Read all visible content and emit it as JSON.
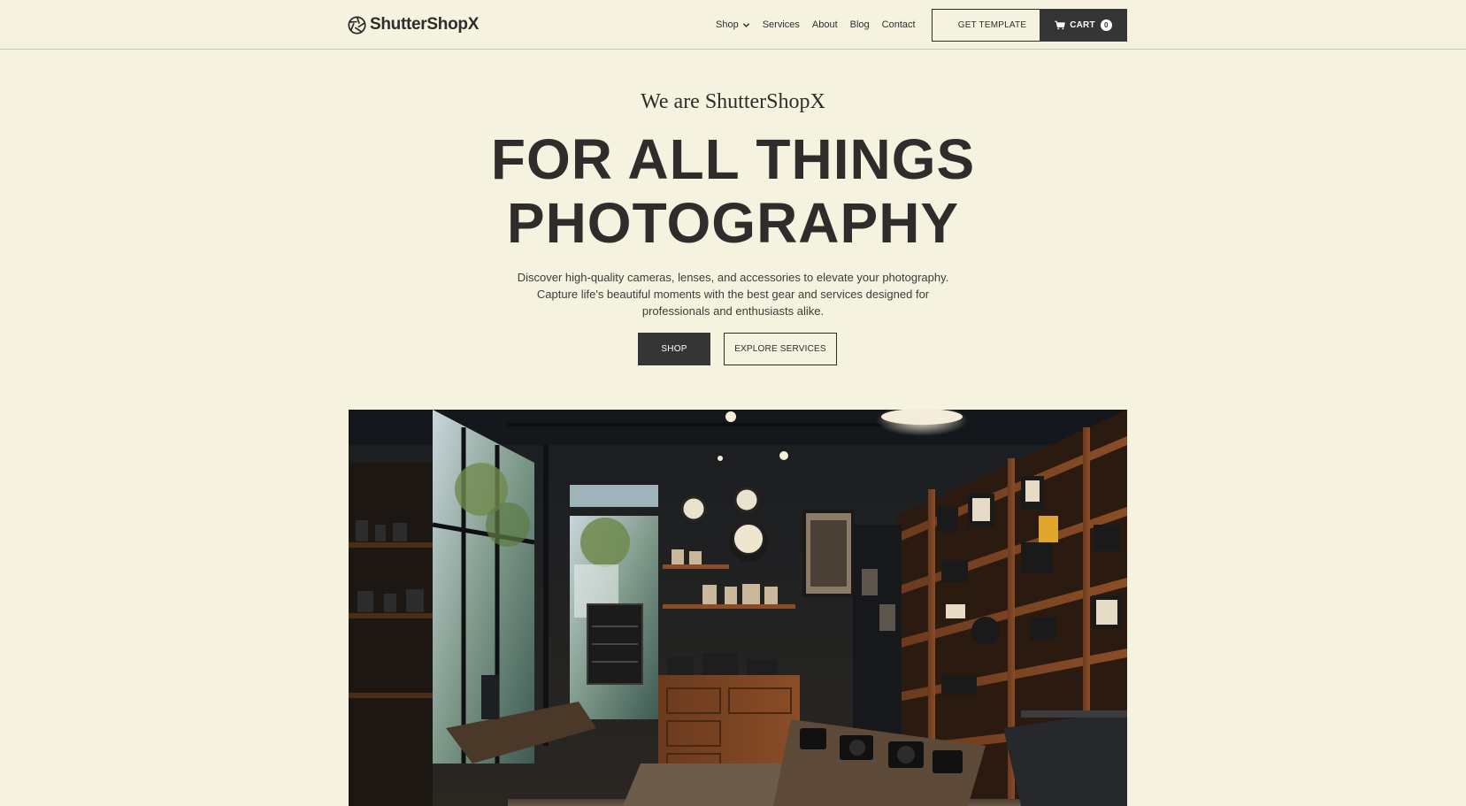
{
  "brand": {
    "name": "ShutterShopX",
    "logo_icon": "aperture-icon"
  },
  "nav": {
    "items": [
      {
        "label": "Shop",
        "has_dropdown": true
      },
      {
        "label": "Services"
      },
      {
        "label": "About"
      },
      {
        "label": "Blog"
      },
      {
        "label": "Contact"
      }
    ],
    "get_template_label": "GET TEMPLATE",
    "cart_label": "CART",
    "cart_count": "0",
    "cart_icon": "cart-icon"
  },
  "hero": {
    "eyebrow": "We are ShutterShopX",
    "title_line1": "FOR ALL THINGS",
    "title_line2": "PHOTOGRAPHY",
    "description": "Discover high-quality cameras, lenses, and accessories to elevate your photography. Capture life's beautiful moments with the best gear and services designed for professionals and enthusiasts alike.",
    "shop_button": "SHOP",
    "explore_button": "EXPLORE SERVICES"
  },
  "colors": {
    "background": "#f5f3df",
    "dark": "#363535",
    "text": "#2e2d2c"
  }
}
